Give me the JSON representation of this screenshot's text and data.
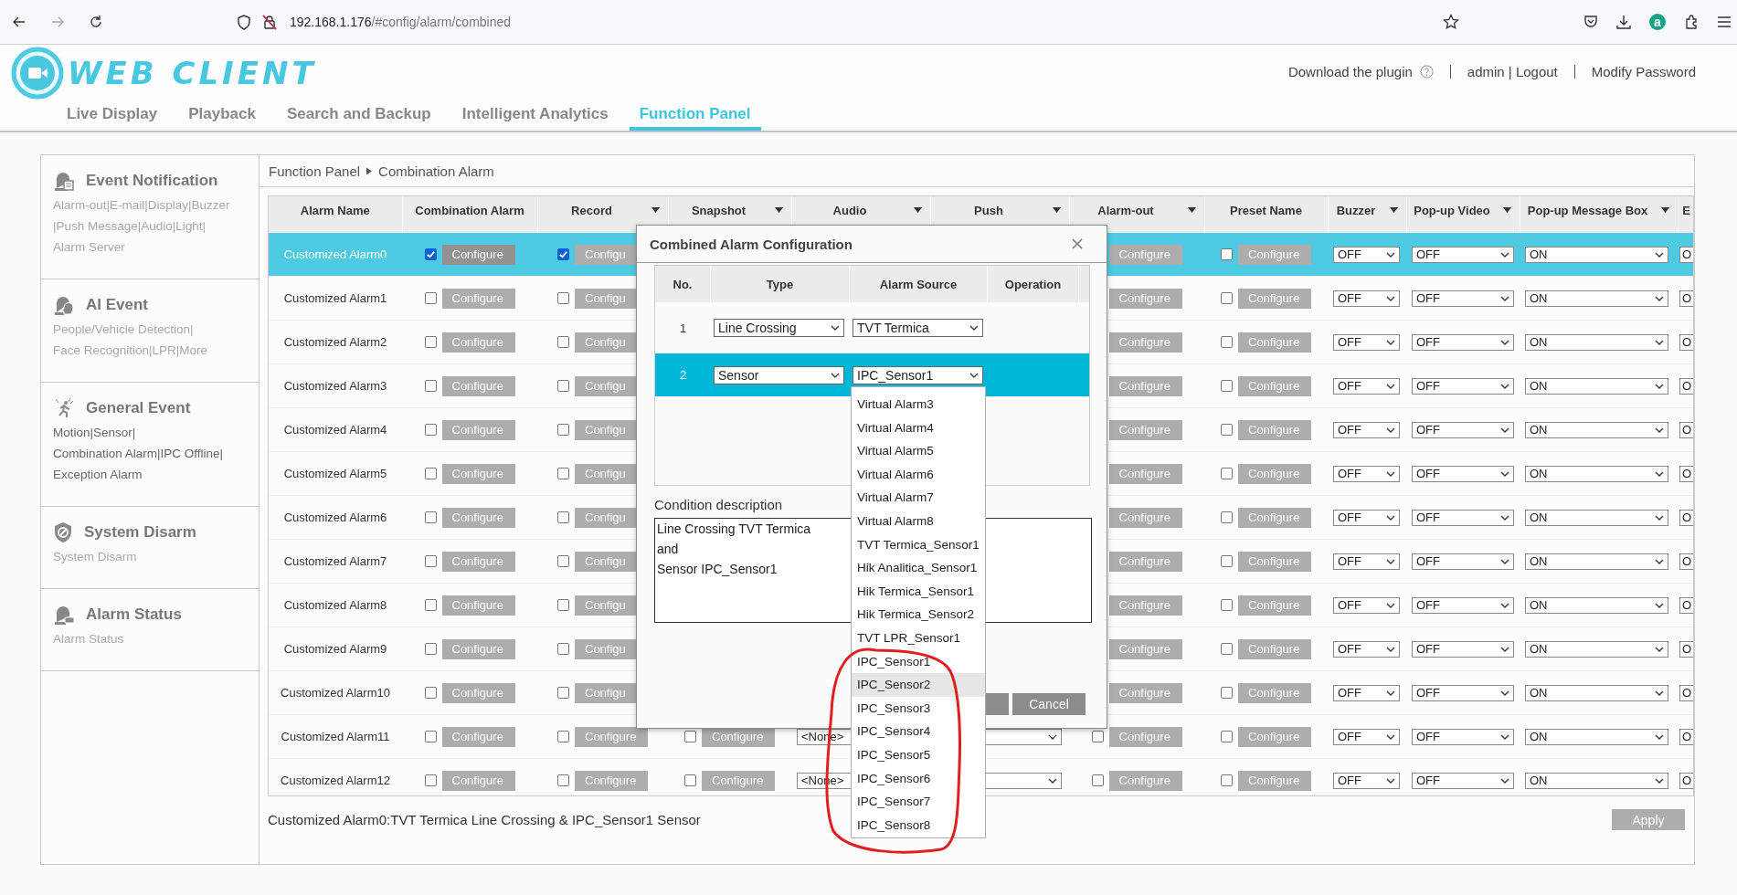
{
  "browser": {
    "url_host": "192.168.1.176",
    "url_path": "/#config/alarm/combined",
    "profile_initial": "a"
  },
  "header": {
    "logo_text": "WEB CLIENT",
    "links": [
      {
        "text": "Download the plugin",
        "kind": "help"
      },
      {
        "text": "admin | Logout",
        "kind": "plain"
      },
      {
        "text": "Modify Password",
        "kind": "plain"
      }
    ],
    "tabs": [
      {
        "label": "Live Display",
        "selected": false
      },
      {
        "label": "Playback",
        "selected": false
      },
      {
        "label": "Search and Backup",
        "selected": false
      },
      {
        "label": "Intelligent Analytics",
        "selected": false
      },
      {
        "label": "Function Panel",
        "selected": true
      }
    ]
  },
  "sidebar": [
    {
      "kind": "notification",
      "title": "Event Notification",
      "subtitle": "Alarm-out|E-mail|Display|Buzzer\n|Push Message|Audio|Light|\nAlarm Server",
      "selected": false
    },
    {
      "kind": "ai",
      "title": "AI Event",
      "subtitle": "People/Vehicle Detection|\nFace Recognition|LPR|More",
      "selected": false
    },
    {
      "kind": "general",
      "title": "General Event",
      "subtitle": "Motion|Sensor|\nCombination Alarm|IPC Offline|\nException Alarm",
      "selected": true
    },
    {
      "kind": "disarm",
      "title": "System Disarm",
      "subtitle": "System Disarm",
      "selected": false
    },
    {
      "kind": "status",
      "title": "Alarm Status",
      "subtitle": "Alarm Status",
      "selected": false
    }
  ],
  "breadcrumb": [
    "Function Panel",
    "Combination Alarm"
  ],
  "table": {
    "columns": [
      {
        "label": "Alarm Name",
        "dropdown": false
      },
      {
        "label": "Combination Alarm",
        "dropdown": false
      },
      {
        "label": "Record",
        "dropdown": true
      },
      {
        "label": "Snapshot",
        "dropdown": true
      },
      {
        "label": "Audio",
        "dropdown": true
      },
      {
        "label": "Push",
        "dropdown": true
      },
      {
        "label": "Alarm-out",
        "dropdown": true
      },
      {
        "label": "Preset Name",
        "dropdown": false
      },
      {
        "label": "Buzzer",
        "dropdown": true
      },
      {
        "label": "Pop-up Video",
        "dropdown": true
      },
      {
        "label": "Pop-up Message Box",
        "dropdown": true
      },
      {
        "label": "E",
        "dropdown": false
      }
    ],
    "rows": [
      {
        "name": "Customized Alarm0",
        "selected": true,
        "combination": {
          "checked": true,
          "button": "Configure"
        },
        "record": {
          "checked": true,
          "button": "Configu"
        },
        "alarm_out": {
          "button": "Configure"
        },
        "preset": {
          "checked": false,
          "button": "Configure"
        },
        "buzzer": "OFF",
        "popup_video": "OFF",
        "popup_message": "ON",
        "column_12": "O"
      },
      {
        "name": "Customized Alarm1",
        "selected": false,
        "combination": {
          "checked": false,
          "button": "Configure"
        },
        "record": {
          "checked": false,
          "button": "Configu"
        },
        "alarm_out": {
          "button": "Configure"
        },
        "preset": {
          "checked": false,
          "button": "Configure"
        },
        "buzzer": "OFF",
        "popup_video": "OFF",
        "popup_message": "ON",
        "column_12": "O"
      },
      {
        "name": "Customized Alarm2",
        "selected": false,
        "combination": {
          "checked": false,
          "button": "Configure"
        },
        "record": {
          "checked": false,
          "button": "Configu"
        },
        "alarm_out": {
          "button": "Configure"
        },
        "preset": {
          "checked": false,
          "button": "Configure"
        },
        "buzzer": "OFF",
        "popup_video": "OFF",
        "popup_message": "ON",
        "column_12": "O"
      },
      {
        "name": "Customized Alarm3",
        "selected": false,
        "combination": {
          "checked": false,
          "button": "Configure"
        },
        "record": {
          "checked": false,
          "button": "Configu"
        },
        "alarm_out": {
          "button": "Configure"
        },
        "preset": {
          "checked": false,
          "button": "Configure"
        },
        "buzzer": "OFF",
        "popup_video": "OFF",
        "popup_message": "ON",
        "column_12": "O"
      },
      {
        "name": "Customized Alarm4",
        "selected": false,
        "combination": {
          "checked": false,
          "button": "Configure"
        },
        "record": {
          "checked": false,
          "button": "Configu"
        },
        "alarm_out": {
          "button": "Configure"
        },
        "preset": {
          "checked": false,
          "button": "Configure"
        },
        "buzzer": "OFF",
        "popup_video": "OFF",
        "popup_message": "ON",
        "column_12": "O"
      },
      {
        "name": "Customized Alarm5",
        "selected": false,
        "combination": {
          "checked": false,
          "button": "Configure"
        },
        "record": {
          "checked": false,
          "button": "Configu"
        },
        "alarm_out": {
          "button": "Configure"
        },
        "preset": {
          "checked": false,
          "button": "Configure"
        },
        "buzzer": "OFF",
        "popup_video": "OFF",
        "popup_message": "ON",
        "column_12": "O"
      },
      {
        "name": "Customized Alarm6",
        "selected": false,
        "combination": {
          "checked": false,
          "button": "Configure"
        },
        "record": {
          "checked": false,
          "button": "Configu"
        },
        "alarm_out": {
          "button": "Configure"
        },
        "preset": {
          "checked": false,
          "button": "Configure"
        },
        "buzzer": "OFF",
        "popup_video": "OFF",
        "popup_message": "ON",
        "column_12": "O"
      },
      {
        "name": "Customized Alarm7",
        "selected": false,
        "combination": {
          "checked": false,
          "button": "Configure"
        },
        "record": {
          "checked": false,
          "button": "Configu"
        },
        "alarm_out": {
          "button": "Configure"
        },
        "preset": {
          "checked": false,
          "button": "Configure"
        },
        "buzzer": "OFF",
        "popup_video": "OFF",
        "popup_message": "ON",
        "column_12": "O"
      },
      {
        "name": "Customized Alarm8",
        "selected": false,
        "combination": {
          "checked": false,
          "button": "Configure"
        },
        "record": {
          "checked": false,
          "button": "Configu"
        },
        "alarm_out": {
          "button": "Configure"
        },
        "preset": {
          "checked": false,
          "button": "Configure"
        },
        "buzzer": "OFF",
        "popup_video": "OFF",
        "popup_message": "ON",
        "column_12": "O"
      },
      {
        "name": "Customized Alarm9",
        "selected": false,
        "combination": {
          "checked": false,
          "button": "Configure"
        },
        "record": {
          "checked": false,
          "button": "Configu"
        },
        "alarm_out": {
          "button": "Configure"
        },
        "preset": {
          "checked": false,
          "button": "Configure"
        },
        "buzzer": "OFF",
        "popup_video": "OFF",
        "popup_message": "ON",
        "column_12": "O"
      },
      {
        "name": "Customized Alarm10",
        "selected": false,
        "combination": {
          "checked": false,
          "button": "Configure"
        },
        "record": {
          "checked": false,
          "button": "Configu"
        },
        "alarm_out": {
          "button": "Configure"
        },
        "preset": {
          "checked": false,
          "button": "Configure"
        },
        "buzzer": "OFF",
        "popup_video": "OFF",
        "popup_message": "ON",
        "column_12": "O"
      },
      {
        "name": "Customized Alarm11",
        "selected": false,
        "combination": {
          "checked": false,
          "button": "Configure"
        },
        "record": {
          "checked": false,
          "button": "Configure"
        },
        "snapshot": {
          "checked": false,
          "button": "Configure"
        },
        "audio": "<None>",
        "alarm_out": {
          "checked": false,
          "button": "Configure"
        },
        "preset": {
          "checked": false,
          "button": "Configure"
        },
        "buzzer": "OFF",
        "popup_video": "OFF",
        "popup_message": "ON",
        "column_12": "O"
      },
      {
        "name": "Customized Alarm12",
        "selected": false,
        "combination": {
          "checked": false,
          "button": "Configure"
        },
        "record": {
          "checked": false,
          "button": "Configure"
        },
        "snapshot": {
          "checked": false,
          "button": "Configure"
        },
        "audio": "<None>",
        "alarm_out": {
          "checked": false,
          "button": "Configure"
        },
        "preset": {
          "checked": false,
          "button": "Configure"
        },
        "buzzer": "OFF",
        "popup_video": "OFF",
        "popup_message": "ON",
        "column_12": "O"
      }
    ]
  },
  "summary": "Customized Alarm0:TVT Termica Line Crossing & IPC_Sensor1 Sensor",
  "apply_button": "Apply",
  "dialog": {
    "title": "Combined Alarm Configuration",
    "columns": [
      "No.",
      "Type",
      "Alarm Source",
      "Operation"
    ],
    "rows": [
      {
        "no": "1",
        "type": "Line Crossing",
        "source": "TVT Termica",
        "selected": false
      },
      {
        "no": "2",
        "type": "Sensor",
        "source": "IPC_Sensor1",
        "selected": true
      }
    ],
    "condition_label": "Condition description",
    "condition_text": "Line Crossing TVT Termica\nand\nSensor IPC_Sensor1",
    "buttons": [
      {
        "kind": "covered"
      },
      {
        "kind": "text",
        "label": "Cancel"
      }
    ]
  },
  "dropdown": {
    "items": [
      {
        "label": "Virtual Alarm3",
        "highlighted": false
      },
      {
        "label": "Virtual Alarm4",
        "highlighted": false
      },
      {
        "label": "Virtual Alarm5",
        "highlighted": false
      },
      {
        "label": "Virtual Alarm6",
        "highlighted": false
      },
      {
        "label": "Virtual Alarm7",
        "highlighted": false
      },
      {
        "label": "Virtual Alarm8",
        "highlighted": false
      },
      {
        "label": "TVT Termica_Sensor1",
        "highlighted": false
      },
      {
        "label": "Hik Analitica_Sensor1",
        "highlighted": false
      },
      {
        "label": "Hik Termica_Sensor1",
        "highlighted": false
      },
      {
        "label": "Hik Termica_Sensor2",
        "highlighted": false
      },
      {
        "label": "TVT LPR_Sensor1",
        "highlighted": false
      },
      {
        "label": "IPC_Sensor1",
        "highlighted": false
      },
      {
        "label": "IPC_Sensor2",
        "highlighted": true
      },
      {
        "label": "IPC_Sensor3",
        "highlighted": false
      },
      {
        "label": "IPC_Sensor4",
        "highlighted": false
      },
      {
        "label": "IPC_Sensor5",
        "highlighted": false
      },
      {
        "label": "IPC_Sensor6",
        "highlighted": false
      },
      {
        "label": "IPC_Sensor7",
        "highlighted": false
      },
      {
        "label": "IPC_Sensor8",
        "highlighted": false
      }
    ]
  },
  "annotation": {
    "kind": "freehand-loop"
  }
}
